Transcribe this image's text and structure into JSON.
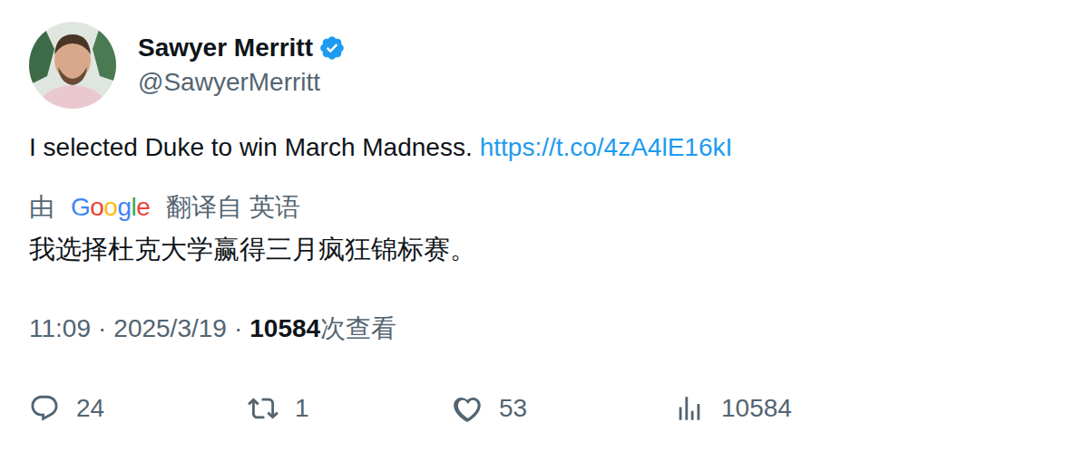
{
  "author": {
    "name": "Sawyer Merritt",
    "handle": "@SawyerMerritt",
    "verified": true
  },
  "tweet": {
    "text": "I selected Duke to win March Madness.",
    "link": "https://t.co/4zA4lE16kI"
  },
  "translation": {
    "prefix": "由",
    "provider": "Google",
    "suffix": "翻译自 英语",
    "text": "我选择杜克大学赢得三月疯狂锦标赛。"
  },
  "meta": {
    "time": "11:09",
    "separator": "·",
    "date": "2025/3/19",
    "views": "10584",
    "views_label": "次查看"
  },
  "actions": [
    {
      "kind": "reply",
      "count": "24"
    },
    {
      "kind": "retweet",
      "count": "1"
    },
    {
      "kind": "like",
      "count": "53"
    },
    {
      "kind": "views",
      "count": "10584"
    }
  ]
}
